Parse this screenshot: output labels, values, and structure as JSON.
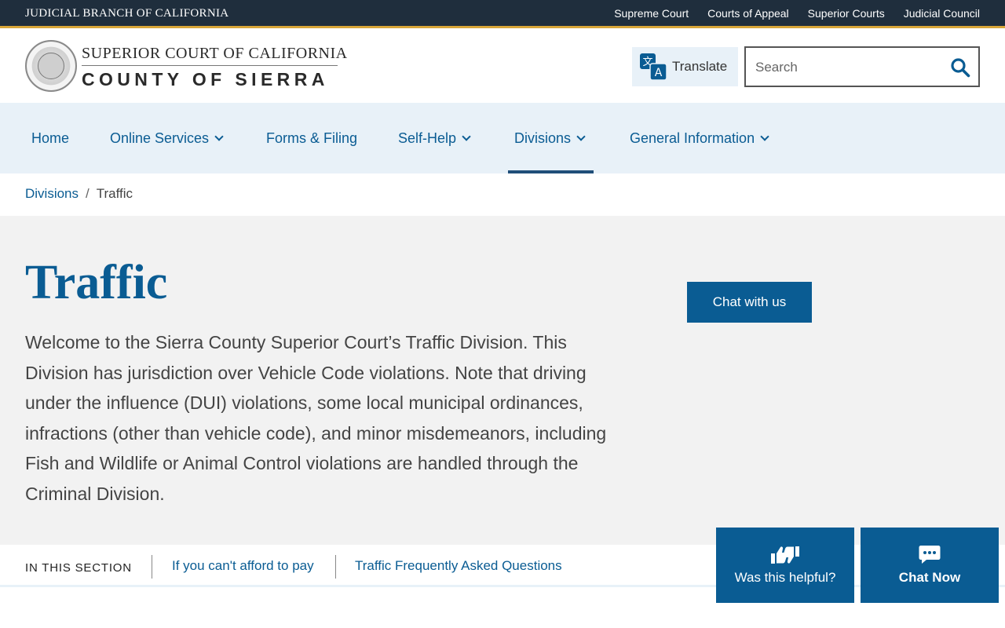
{
  "topbar": {
    "brand": "JUDICIAL BRANCH OF CALIFORNIA",
    "links": [
      "Supreme Court",
      "Courts of Appeal",
      "Superior Courts",
      "Judicial Council"
    ]
  },
  "header": {
    "court_line1": "SUPERIOR COURT OF CALIFORNIA",
    "court_line2": "COUNTY OF SIERRA",
    "translate_label": "Translate",
    "search_placeholder": "Search"
  },
  "nav": {
    "items": [
      {
        "label": "Home",
        "has_dropdown": false,
        "active": false
      },
      {
        "label": "Online Services",
        "has_dropdown": true,
        "active": false
      },
      {
        "label": "Forms & Filing",
        "has_dropdown": false,
        "active": false
      },
      {
        "label": "Self-Help",
        "has_dropdown": true,
        "active": false
      },
      {
        "label": "Divisions",
        "has_dropdown": true,
        "active": true
      },
      {
        "label": "General Information",
        "has_dropdown": true,
        "active": false
      }
    ]
  },
  "breadcrumb": {
    "parent": "Divisions",
    "separator": "/",
    "current": "Traffic"
  },
  "main": {
    "title": "Traffic",
    "intro": "Welcome to the Sierra County Superior Court’s Traffic Division. This Division has jurisdiction over Vehicle Code violations. Note that driving under the influence (DUI) violations, some local municipal ordinances, infractions (other than vehicle code), and minor misdemeanors, including Fish and Wildlife or Animal Control violations are handled through the Criminal Division.",
    "chat_button": "Chat with us"
  },
  "in_section": {
    "label": "IN THIS SECTION",
    "links": [
      "If you can't afford to pay",
      "Traffic Frequently Asked Questions"
    ]
  },
  "widgets": {
    "helpful_label": "Was this helpful?",
    "chat_now_label": "Chat Now"
  },
  "colors": {
    "topbar_bg": "#1f2e3d",
    "gold_accent": "#d8a639",
    "primary_blue": "#0a5c93",
    "nav_bg": "#e8f1f8",
    "hero_bg": "#f2f2f2"
  }
}
